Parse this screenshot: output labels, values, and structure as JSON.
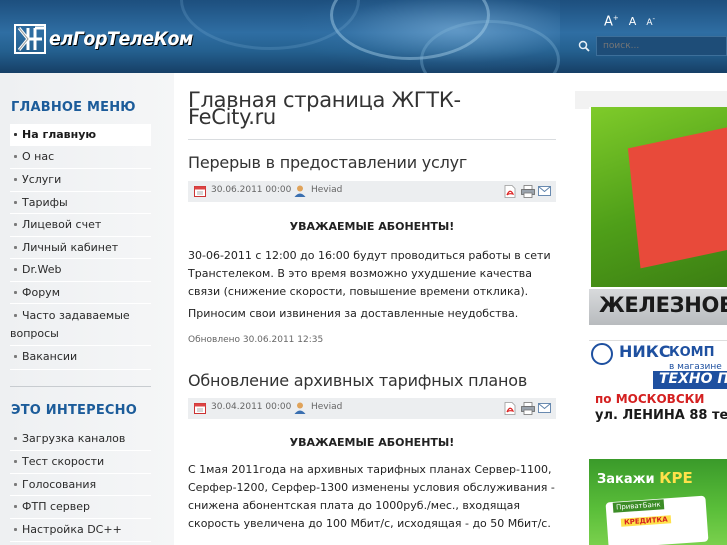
{
  "header": {
    "logo_text": "елГорТелеКом",
    "font_controls": {
      "increase": "A",
      "increase_mark": "+",
      "reset": "A",
      "decrease": "A",
      "decrease_mark": "-"
    },
    "search": {
      "placeholder": "поиск..."
    }
  },
  "sidebar": {
    "main_menu_title": "ГЛАВНОЕ МЕНЮ",
    "main_menu": [
      {
        "label": "На главную"
      },
      {
        "label": "О нас"
      },
      {
        "label": "Услуги"
      },
      {
        "label": "Тарифы"
      },
      {
        "label": "Лицевой счет"
      },
      {
        "label": "Личный кабинет"
      },
      {
        "label": "Dr.Web"
      },
      {
        "label": "Форум"
      },
      {
        "label": "Часто задаваемые вопросы"
      },
      {
        "label": "Вакансии"
      }
    ],
    "interesting_title": "ЭТО ИНТЕРЕСНО",
    "interesting_menu": [
      {
        "label": "Загрузка каналов"
      },
      {
        "label": "Тест скорости"
      },
      {
        "label": "Голосования"
      },
      {
        "label": "ФТП сервер"
      },
      {
        "label": "Настройка DC++"
      }
    ]
  },
  "main": {
    "page_title": "Главная страница ЖГТК-FeCity.ru",
    "articles": [
      {
        "title": "Перерыв в предоставлении услуг",
        "date": "30.06.2011 00:00",
        "author": "Heviad",
        "heading": "УВАЖАЕМЫЕ АБОНЕНТЫ!",
        "paragraph1": "30-06-2011 с 12:00 до 16:00 будут проводиться работы в сети Транстелеком. В это время возможно ухудшение качества связи (снижение скорости, повышение времени отклика).",
        "paragraph2": "Приносим свои извинения за доставленные неудобства.",
        "updated": "Обновлено 30.06.2011 12:35"
      },
      {
        "title": "Обновление архивных тарифных планов",
        "date": "30.04.2011 00:00",
        "author": "Heviad",
        "heading": "УВАЖАЕМЫЕ АБОНЕНТЫ!",
        "paragraph1": "С  1мая  2011года на архивных тарифных планах Сервер-1100, Серфер-1200, Серфер-1300 изменены условия обслуживания   - снижена абонентская плата до  1000руб./мес., входящая скорость увеличена до 100 Мбит/с, исходящая - до 50 Мбит/с."
      }
    ]
  },
  "banners": {
    "banner1_text": "ЖЕЛЕЗНОЕ",
    "banner2": {
      "line1": "НИКС",
      "line1b": "КОМП",
      "line2": "в магазине",
      "line3": "ТЕХНО ПА",
      "line4": "по МОСКОВСКИ",
      "line5": "ул. ЛЕНИНА 88 те"
    },
    "banner3": {
      "text_prefix": "Закажи",
      "text_highlight": "КРЕ",
      "bank": "ПриватБанк",
      "card_label": "КРЕДИТКА"
    }
  },
  "colors": {
    "header_blue": "#2f6ea3",
    "menu_heading": "#1c5c9a",
    "sidebar_bg": "#eef0f2"
  }
}
